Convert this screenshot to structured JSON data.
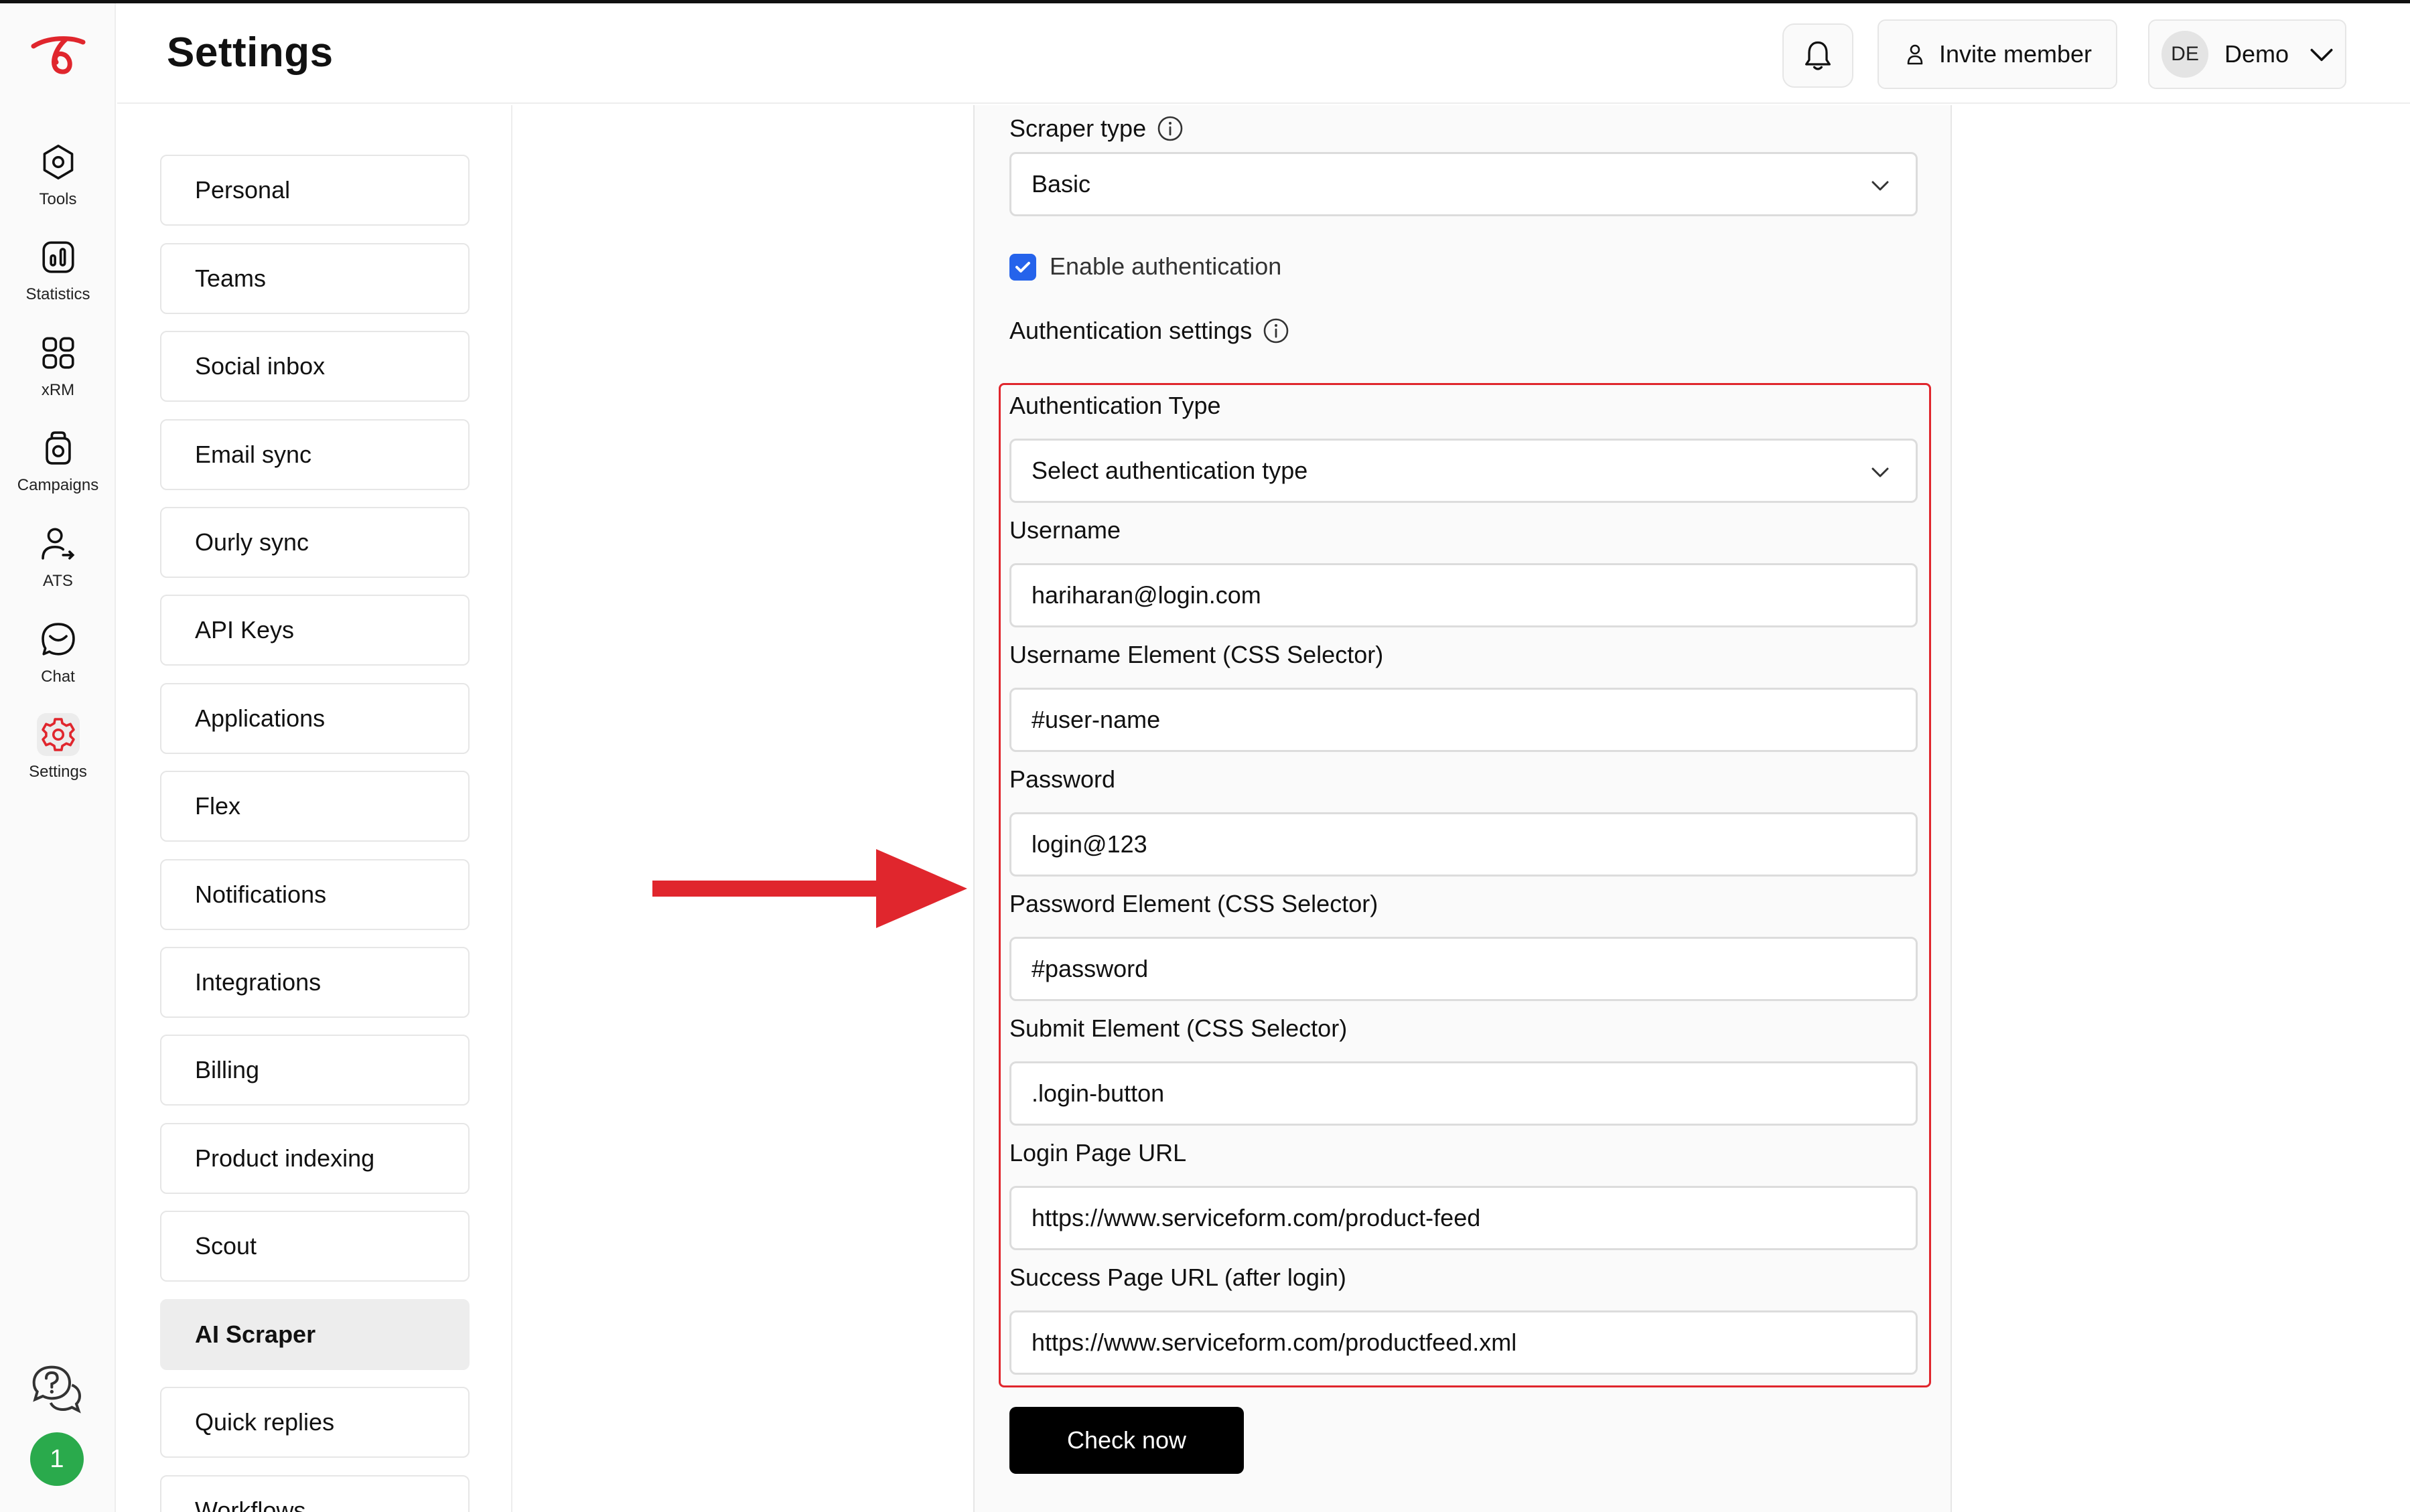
{
  "header": {
    "title": "Settings",
    "invite_label": "Invite member",
    "avatar_initials": "DE",
    "account_name": "Demo"
  },
  "rail": {
    "items": [
      {
        "label": "Tools",
        "icon": "tools-icon"
      },
      {
        "label": "Statistics",
        "icon": "statistics-icon"
      },
      {
        "label": "xRM",
        "icon": "xrm-icon"
      },
      {
        "label": "Campaigns",
        "icon": "campaigns-icon"
      },
      {
        "label": "ATS",
        "icon": "ats-icon"
      },
      {
        "label": "Chat",
        "icon": "chat-icon"
      },
      {
        "label": "Settings",
        "icon": "settings-icon"
      }
    ],
    "active": "Settings",
    "user_badge": "1",
    "brand_color": "#e0262d",
    "badge_color": "#2aaa4c"
  },
  "settings_nav": {
    "items": [
      "Personal",
      "Teams",
      "Social inbox",
      "Email sync",
      "Ourly sync",
      "API Keys",
      "Applications",
      "Flex",
      "Notifications",
      "Integrations",
      "Billing",
      "Product indexing",
      "Scout",
      "AI Scraper",
      "Quick replies",
      "Workflows"
    ],
    "active": "AI Scraper"
  },
  "form": {
    "scraper_type_label": "Scraper type",
    "scraper_type_value": "Basic",
    "enable_auth_label": "Enable authentication",
    "enable_auth_checked": true,
    "auth_settings_label": "Authentication settings",
    "auth_type_label": "Authentication Type",
    "auth_type_value": "Select authentication type",
    "username_label": "Username",
    "username_value": "hariharan@login.com",
    "username_selector_label": "Username Element (CSS Selector)",
    "username_selector_value": "#user-name",
    "password_label": "Password",
    "password_value": "login@123",
    "password_selector_label": "Password Element (CSS Selector)",
    "password_selector_value": "#password",
    "submit_selector_label": "Submit Element (CSS Selector)",
    "submit_selector_value": ".login-button",
    "login_url_label": "Login Page URL",
    "login_url_value": "https://www.serviceform.com/product-feed",
    "success_url_label": "Success Page URL (after login)",
    "success_url_value": "https://www.serviceform.com/productfeed.xml",
    "submit_label": "Check now",
    "highlight_color": "#e0262d",
    "checkbox_color": "#2563eb"
  }
}
